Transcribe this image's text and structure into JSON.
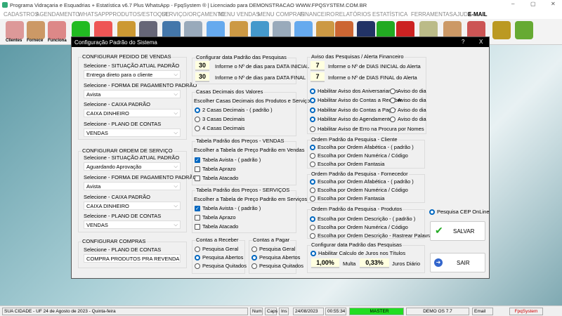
{
  "app": {
    "title": "Programa Vidraçaria e Esquadrias + Estatística v6.7 Plus WhatsApp - FpqSystem ® | Licenciado para  DEMONSTRACAO WWW.FPQSYSTEM.COM.BR"
  },
  "menu": [
    "CADASTROS",
    "AGENDAMENTO",
    "WHATSAPP",
    "PRODUTOS/ESTOQUE",
    "SERVIÇO/ORÇAMENTO",
    "MENU VENDAS",
    "MENU COMPRAS",
    "FINANCEIRO",
    "RELATÓRIOS",
    "ESTATÍSTICA",
    "FERRAMENTAS",
    "AJUDA",
    "E-MAIL"
  ],
  "toolbar": {
    "labels": [
      "Clientes",
      "Fornece",
      "Funciona"
    ],
    "icons": [
      "clients-icon",
      "suppliers-icon",
      "employees-icon",
      "whatsapp-icon",
      "calendar-icon",
      "boxes-icon",
      "barcode-icon",
      "clipboard-icon",
      "search-doc-icon",
      "folder-edit-icon",
      "archive-icon",
      "monitor-icon",
      "search-doc-icon",
      "folder-edit-icon",
      "archive-icon",
      "finance-chart-icon",
      "money-book-icon",
      "dollar-green-icon",
      "dollar-red-icon",
      "check-icon",
      "scroll-icon",
      "support-icon",
      "coins-icon",
      "exit-icon"
    ]
  },
  "dialog": {
    "title": "Configuração Padrão do Sistema",
    "help": "?",
    "close": "X",
    "vendas": {
      "title": "CONFIGURAR PEDIDO DE VENDAS",
      "sit_label": "Selecione - SITUAÇÃO ATUAL PADRÃO",
      "sit": "Entrega direto para o cliente",
      "pag_label": "Selecione - FORMA DE PAGAMENTO PADRÃO",
      "pag": "Avista",
      "caixa_label": "Selecione - CAIXA PADRÃO",
      "caixa": "CAIXA DINHEIRO",
      "plano_label": "Selecione - PLANO DE CONTAS",
      "plano": "VENDAS"
    },
    "os": {
      "title": "CONFIGURAR ORDEM DE SERVIÇO",
      "sit_label": "Selecione - SITUAÇÃO ATUAL PADRÃO",
      "sit": "Aguardando Aprovação",
      "pag_label": "Selecione - FORMA DE PAGAMENTO PADRÃO",
      "pag": "Avista",
      "caixa_label": "Selecione - CAIXA PADRÃO",
      "caixa": "CAIXA DINHEIRO",
      "plano_label": "Selecione - PLANO DE CONTAS",
      "plano": "VENDAS"
    },
    "compras": {
      "title": "CONFIGURAR COMPRAS",
      "plano_label": "Selecione - PLANO DE CONTAS",
      "plano": "COMPRA PRODUTOS PRA REVENDA"
    },
    "datas": {
      "title": "Configurar data Padrão das Pesquisas",
      "ini": "30",
      "ini_label": "Informe o Nº de dias para DATA INICIAL",
      "fim": "30",
      "fim_label": "Informe o Nº de dias para DATA FINAL"
    },
    "casas": {
      "title": "Casas Decimais dos Valores",
      "sub": "Escolher Casas Decimais dos Produtos e Serviços",
      "opts": [
        "2 Casas Decimais - ( padrão )",
        "3 Casas Decimais",
        "4 Casas Decimais"
      ],
      "selected": 0
    },
    "tab_vendas": {
      "title": "Tabela Padrão dos Preços - VENDAS",
      "sub": "Escolher a Tabela de Preço Padrão em Vendas",
      "opts": [
        "Tabela Avista - ( padrão )",
        "Tabela Aprazo",
        "Tabela Atacado"
      ],
      "checked": [
        true,
        false,
        false
      ]
    },
    "tab_serv": {
      "title": "Tabela Padrão dos Preços - SERVIÇOS",
      "sub": "Escolher a Tabela de Preço Padrão em Serviços",
      "opts": [
        "Tabela Avista - ( padrão )",
        "Tabela Aprazo",
        "Tabela Atacado"
      ],
      "checked": [
        true,
        false,
        false
      ]
    },
    "receber": {
      "title": "Contas a Receber",
      "opts": [
        "Pesquisa Geral",
        "Pesquisa Abertos",
        "Pesquisa Quitados"
      ],
      "selected": 1
    },
    "pagar": {
      "title": "Contas a Pagar",
      "opts": [
        "Pesquisa Geral",
        "Pesquisa Abertos",
        "Pesquisa Quitados"
      ],
      "selected": 1
    },
    "aviso": {
      "title": "Aviso das Pesquisas / Alerta Financeiro",
      "ini": "7",
      "ini_label": "Informe o Nº de DIAS INICIAL do Alerta",
      "fim": "7",
      "fim_label": "Informe o Nº de DIAS FINAL do Alerta",
      "opts": [
        "Habilitar Aviso dos Aniversariantes",
        "Habilitar Aviso do Contas a Receber",
        "Habilitar Aviso do Contas a Pagar",
        "Habilitar Aviso do Agendamento",
        "Habilitar Aviso de Erro na Procura por Nomes"
      ],
      "on": [
        true,
        true,
        true,
        true,
        false
      ],
      "dia": "Aviso do dia"
    },
    "cliente": {
      "title": "Ordem Padrão da Pesquisa - Cliente",
      "opts": [
        "Escolha por Ordem Afabética - ( padrão )",
        "Escolha por Ordem Numérica / Código",
        "Escolha por Ordem Fantasia"
      ],
      "selected": 0
    },
    "fornecedor": {
      "title": "Ordem Padrão da Pesquisa - Fornecedor",
      "opts": [
        "Escolha por Ordem Afabética - ( padrão )",
        "Escolha por Ordem Numérica / Código",
        "Escolha por Ordem Fantasia"
      ],
      "selected": 0
    },
    "produtos": {
      "title": "Ordem Padrão da Pesquisa - Produtos",
      "opts": [
        "Escolha por Ordem Descrição - ( padrão )",
        "Escolha por Ordem Numérica / Código",
        "Escolha por Ordem Descrição - Rastrear Palavra"
      ],
      "selected": 0
    },
    "juros": {
      "title": "Configurar data Padrão das Pesquisas",
      "opt": "Habilitar Calculo de Juros nos Títulos",
      "multa": "1,00%",
      "multa_label": "Multa",
      "juros": "0,33%",
      "juros_label": "Juros Diário"
    },
    "cep": "Pesquisa CEP OnLine",
    "salvar": "SALVAR",
    "sair": "SAIR"
  },
  "status": {
    "city": "SUA CIDADE - UF 24 de Agosto de 2023 - Quinta-feira",
    "num": "Num",
    "caps": "Caps",
    "ins": "Ins",
    "date": "24/08/2023",
    "time": "00:55:34",
    "user": "MASTER",
    "version": "DEMO OS 7.7",
    "email": "Email",
    "brand": "FpqSystem"
  },
  "colors": {
    "accent": "#0067c0",
    "status_user": "#22dd22",
    "brand": "#cc0000"
  }
}
